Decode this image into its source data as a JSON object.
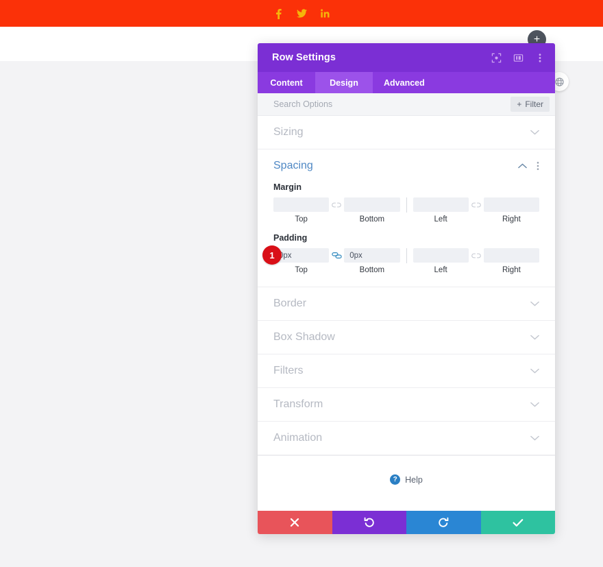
{
  "site": {
    "topbar": {
      "background": "#fb3108",
      "icon_color": "#f5b50a",
      "social": [
        {
          "name": "facebook-icon",
          "label": "Facebook"
        },
        {
          "name": "twitter-icon",
          "label": "Twitter"
        },
        {
          "name": "linkedin-icon",
          "label": "LinkedIn"
        }
      ]
    },
    "add_row_button": {
      "label": "+",
      "background": "#4e545e"
    },
    "edge_icon": {
      "name": "globe-icon"
    }
  },
  "modal": {
    "title": "Row Settings",
    "accent": "#7b2fd4",
    "header_icons": [
      {
        "name": "focus-icon"
      },
      {
        "name": "layout-columns-icon"
      },
      {
        "name": "more-vertical-icon"
      }
    ],
    "tabs": [
      {
        "label": "Content",
        "active": false
      },
      {
        "label": "Design",
        "active": true
      },
      {
        "label": "Advanced",
        "active": false
      }
    ],
    "search": {
      "placeholder": "Search Options",
      "value": "",
      "filter_label": "Filter",
      "filter_plus": "+"
    },
    "sections": [
      {
        "title": "Sizing",
        "open": false
      },
      {
        "title": "Spacing",
        "open": true
      },
      {
        "title": "Border",
        "open": false
      },
      {
        "title": "Box Shadow",
        "open": false
      },
      {
        "title": "Filters",
        "open": false
      },
      {
        "title": "Transform",
        "open": false
      },
      {
        "title": "Animation",
        "open": false
      }
    ],
    "spacing": {
      "margin": {
        "label": "Margin",
        "top": {
          "label": "Top",
          "value": ""
        },
        "bottom": {
          "label": "Bottom",
          "value": ""
        },
        "left": {
          "label": "Left",
          "value": ""
        },
        "right": {
          "label": "Right",
          "value": ""
        },
        "link_topbottom": false,
        "link_leftright": false
      },
      "padding": {
        "label": "Padding",
        "top": {
          "label": "Top",
          "value": "0px"
        },
        "bottom": {
          "label": "Bottom",
          "value": "0px"
        },
        "left": {
          "label": "Left",
          "value": ""
        },
        "right": {
          "label": "Right",
          "value": ""
        },
        "link_topbottom": true,
        "link_leftright": false,
        "badge": "1"
      }
    },
    "help": {
      "label": "Help",
      "icon_char": "?"
    },
    "actions": [
      {
        "name": "cancel-button",
        "icon": "close-icon",
        "color": "#e8545a"
      },
      {
        "name": "undo-button",
        "icon": "undo-icon",
        "color": "#7b2fd4"
      },
      {
        "name": "redo-button",
        "icon": "redo-icon",
        "color": "#2a86d4"
      },
      {
        "name": "save-button",
        "icon": "check-icon",
        "color": "#2ec2a0"
      }
    ]
  }
}
